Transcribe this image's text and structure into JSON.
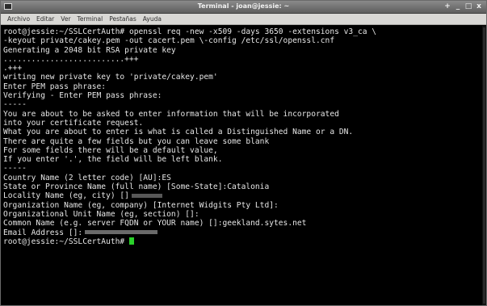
{
  "window": {
    "title": "Terminal - joan@jessie: ~",
    "controls": [
      "+",
      "_",
      "□",
      "x"
    ]
  },
  "menubar": {
    "items": [
      "Archivo",
      "Editar",
      "Ver",
      "Terminal",
      "Pestañas",
      "Ayuda"
    ]
  },
  "terminal": {
    "lines": [
      "root@jessie:~/SSLCertAuth# openssl req -new -x509 -days 3650 -extensions v3_ca \\",
      "-keyout private/cakey.pem -out cacert.pem \\-config /etc/ssl/openssl.cnf",
      "Generating a 2048 bit RSA private key",
      "..........................+++",
      ".+++",
      "writing new private key to 'private/cakey.pem'",
      "Enter PEM pass phrase:",
      "Verifying - Enter PEM pass phrase:",
      "-----",
      "You are about to be asked to enter information that will be incorporated",
      "into your certificate request.",
      "What you are about to enter is what is called a Distinguished Name or a DN.",
      "There are quite a few fields but you can leave some blank",
      "For some fields there will be a default value,",
      "If you enter '.', the field will be left blank.",
      "-----",
      "Country Name (2 letter code) [AU]:ES",
      "State or Province Name (full name) [Some-State]:Catalonia",
      "Locality Name (eg, city) []",
      "Organization Name (eg, company) [Internet Widgits Pty Ltd]:",
      "Organizational Unit Name (eg, section) []:",
      "Common Name (e.g. server FQDN or YOUR name) []:geekland.sytes.net",
      "Email Address []:"
    ],
    "prompt": "root@jessie:~/SSLCertAuth# "
  },
  "colors": {
    "terminal_bg": "#000000",
    "terminal_fg": "#e6e6e6",
    "cursor": "#2ad12a",
    "titlebar": "#6e6e6e",
    "menubar": "#d9d8d5"
  }
}
